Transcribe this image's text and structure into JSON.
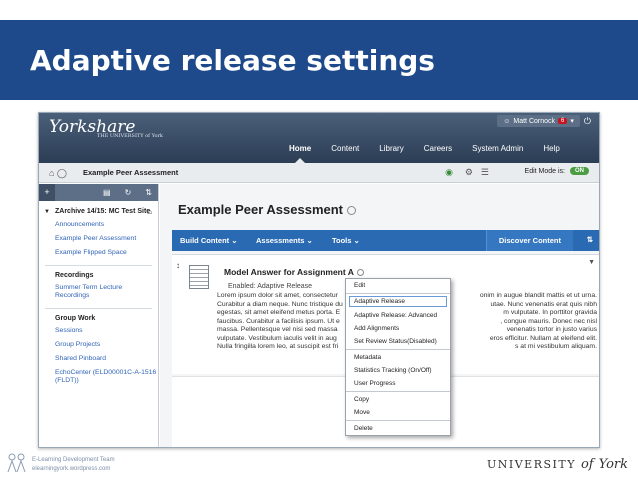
{
  "slide": {
    "title": "Adaptive release settings",
    "footer_team": "E-Learning Development Team",
    "footer_site": "elearningyork.wordpress.com",
    "footer_uni_prefix": "UNIVERSITY",
    "footer_uni_of": "of",
    "footer_uni_york": "York",
    "colors": {
      "header_bg": "#1e4a8c",
      "header_text": "#ffffff"
    }
  },
  "app": {
    "logo": "Yorkshare",
    "logo_sub": "THE UNIVERSITY of York",
    "user_name": "Matt Cornock",
    "notification_count": "6",
    "nav": [
      "Home",
      "Content",
      "Library",
      "Careers",
      "System Admin",
      "Help"
    ],
    "nav_active": "Home",
    "breadcrumb": "Example Peer Assessment",
    "edit_mode_label": "Edit Mode is:",
    "edit_mode_value": "ON"
  },
  "sidebar": {
    "course": "ZArchive 14/15: MC Test Site",
    "links_1": [
      "Announcements",
      "Example Peer Assessment",
      "Example Flipped Space"
    ],
    "section_recordings": "Recordings",
    "links_2": [
      "Summer Term Lecture Recordings"
    ],
    "section_group": "Group Work",
    "links_3": [
      "Sessions",
      "Group Projects",
      "Shared Pinboard",
      "EchoCenter (ELD00001C-A-1516 (FLDT))"
    ]
  },
  "content": {
    "page_title": "Example Peer Assessment",
    "actions": [
      "Build Content",
      "Assessments",
      "Tools"
    ],
    "discover": "Discover Content",
    "item_title": "Model Answer for Assignment A",
    "item_enabled": "Enabled:  Adaptive Release",
    "item_body": [
      "Lorem ipsum dolor sit amet, consectetur",
      "Curabitur a diam neque. Nunc tristique du",
      "egestas, sit amet eleifend metus porta. E",
      "faucibus. Curabitur a facilisis ipsum. Ut e",
      "massa. Pellentesque vel nisi sed massa",
      "vulputate. Vestibulum iaculis velit in aug",
      "Nulla fringilla lorem leo, at suscipit est fri"
    ],
    "item_body_right": [
      "onim in augue blandit mattis et ut urna.",
      "utae. Nunc venenatis erat quis nibh",
      "m vulputate. In porttitor gravida",
      ", congue mauris. Donec nec nisl",
      "venenatis tortor in justo varius",
      "eros efficitur. Nullam at eleifend elit.",
      "s at mi vestibulum aliquam."
    ]
  },
  "menu": {
    "group1": [
      "Edit"
    ],
    "group2": [
      "Adaptive Release",
      "Adaptive Release: Advanced",
      "Add Alignments",
      "Set Review Status(Disabled)"
    ],
    "group3": [
      "Metadata",
      "Statistics Tracking (On/Off)",
      "User Progress"
    ],
    "group4": [
      "Copy",
      "Move"
    ],
    "group5": [
      "Delete"
    ],
    "highlighted": "Adaptive Release"
  }
}
